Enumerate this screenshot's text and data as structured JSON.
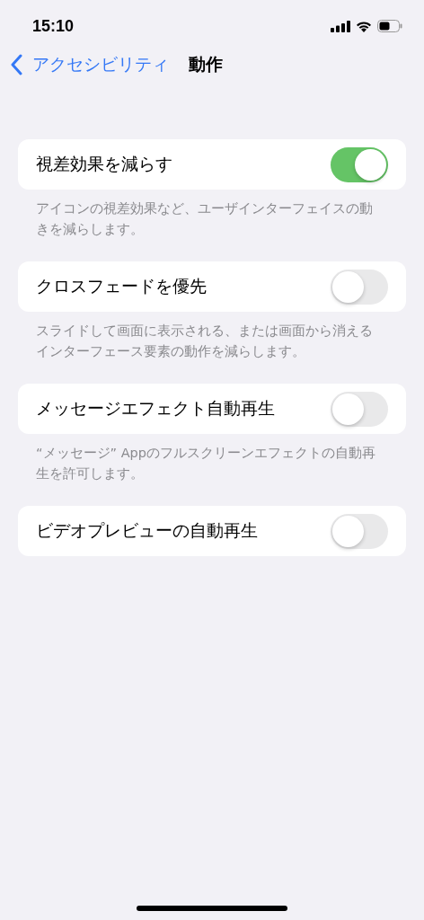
{
  "status_bar": {
    "time": "15:10"
  },
  "nav": {
    "back_label": "アクセシビリティ",
    "title": "動作"
  },
  "settings": [
    {
      "label": "視差効果を減らす",
      "on": true,
      "footer": "アイコンの視差効果など、ユーザインターフェイスの動きを減らします。"
    },
    {
      "label": "クロスフェードを優先",
      "on": false,
      "footer": "スライドして画面に表示される、または画面から消えるインターフェース要素の動作を減らします。"
    },
    {
      "label": "メッセージエフェクト自動再生",
      "on": false,
      "footer": "“メッセージ” Appのフルスクリーンエフェクトの自動再生を許可します。"
    },
    {
      "label": "ビデオプレビューの自動再生",
      "on": false
    }
  ]
}
